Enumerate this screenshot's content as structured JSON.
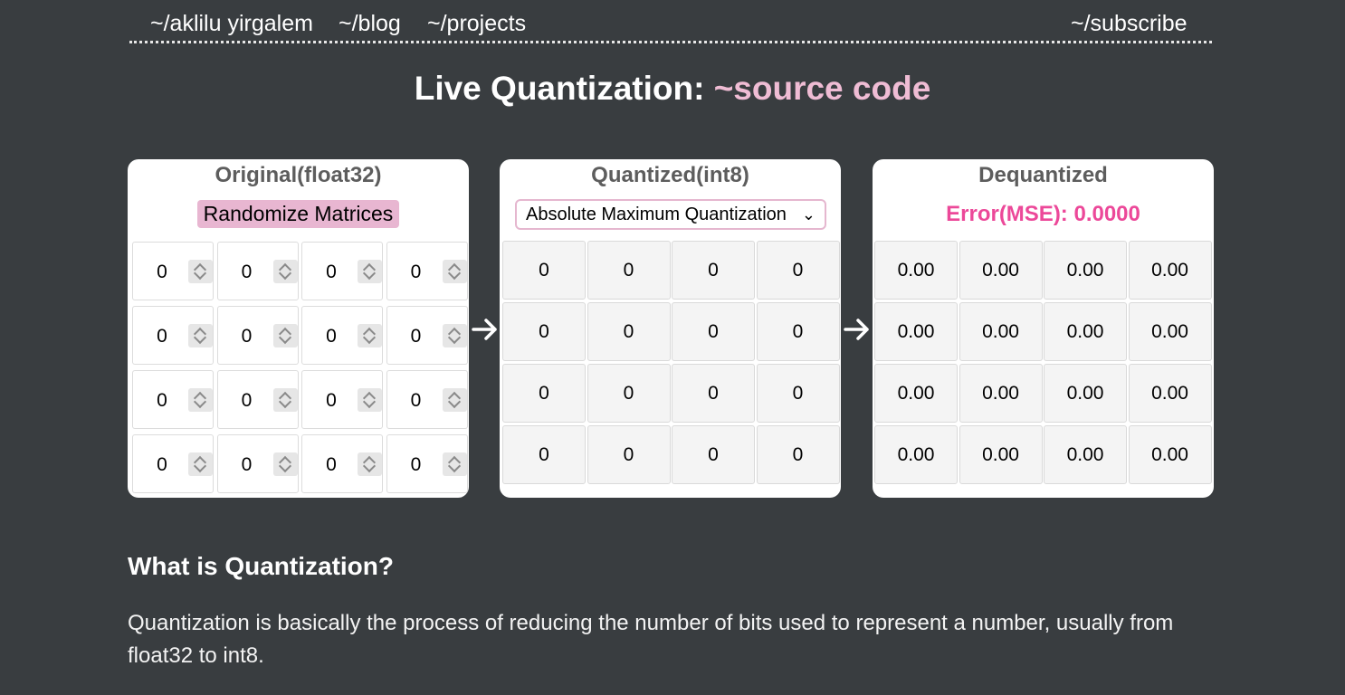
{
  "nav": {
    "home": "~/aklilu yirgalem",
    "blog": "~/blog",
    "projects": "~/projects",
    "subscribe": "~/subscribe"
  },
  "title": {
    "text": "Live Quantization: ",
    "link": "~source code"
  },
  "original": {
    "heading": "Original(float32)",
    "button": "Randomize Matrices",
    "rows": [
      [
        "0",
        "0",
        "0",
        "0"
      ],
      [
        "0",
        "0",
        "0",
        "0"
      ],
      [
        "0",
        "0",
        "0",
        "0"
      ],
      [
        "0",
        "0",
        "0",
        "0"
      ]
    ]
  },
  "quantized": {
    "heading": "Quantized(int8)",
    "method": "Absolute Maximum Quantization",
    "rows": [
      [
        "0",
        "0",
        "0",
        "0"
      ],
      [
        "0",
        "0",
        "0",
        "0"
      ],
      [
        "0",
        "0",
        "0",
        "0"
      ],
      [
        "0",
        "0",
        "0",
        "0"
      ]
    ]
  },
  "dequantized": {
    "heading": "Dequantized",
    "error": "Error(MSE): 0.0000",
    "rows": [
      [
        "0.00",
        "0.00",
        "0.00",
        "0.00"
      ],
      [
        "0.00",
        "0.00",
        "0.00",
        "0.00"
      ],
      [
        "0.00",
        "0.00",
        "0.00",
        "0.00"
      ],
      [
        "0.00",
        "0.00",
        "0.00",
        "0.00"
      ]
    ]
  },
  "section": {
    "heading": "What is Quantization?",
    "body": "Quantization is basically the process of reducing the number of bits used to represent a number, usually from float32 to int8."
  },
  "colors": {
    "background": "#393d40",
    "accent": "#efbcd4",
    "error": "#ec4899"
  }
}
